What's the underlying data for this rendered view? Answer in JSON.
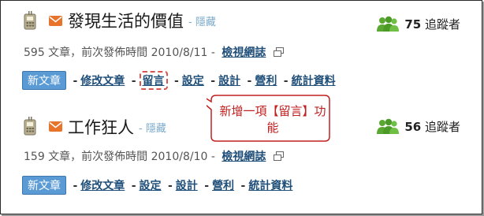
{
  "blogs": [
    {
      "title": "發現生活的價值",
      "hidden_label": "- 隱藏",
      "followers": {
        "count": "75",
        "label": "追蹤者"
      },
      "meta": "595 文章，前次發佈時間 2010/8/11 -",
      "view_blog": "檢視網誌",
      "new_post": "新文章",
      "actions": {
        "edit_posts": "修改文章",
        "comments": "留言",
        "settings": "設定",
        "design": "設計",
        "monetize": "營利",
        "stats": "統計資料"
      },
      "separator": "-"
    },
    {
      "title": "工作狂人",
      "hidden_label": "- 隱藏",
      "followers": {
        "count": "56",
        "label": "追蹤者"
      },
      "meta": "159 文章，前次發佈時間 2010/8/10 -",
      "view_blog": "檢視網誌",
      "new_post": "新文章",
      "actions": {
        "edit_posts": "修改文章",
        "settings": "設定",
        "design": "設計",
        "monetize": "營利",
        "stats": "統計資料"
      },
      "separator": "-"
    }
  ],
  "callout": {
    "text": "新增一項【留言】功能"
  },
  "icons": {
    "mobile": "mobile-phone-icon",
    "mail": "mail-icon",
    "followers": "people-icon",
    "external": "external-link-icon"
  },
  "colors": {
    "link": "#1f4e79",
    "new_post_bg": "#5b9bd5",
    "callout_red": "#c0201f",
    "people_green": "#5aa832",
    "mail_orange": "#e8732a"
  }
}
